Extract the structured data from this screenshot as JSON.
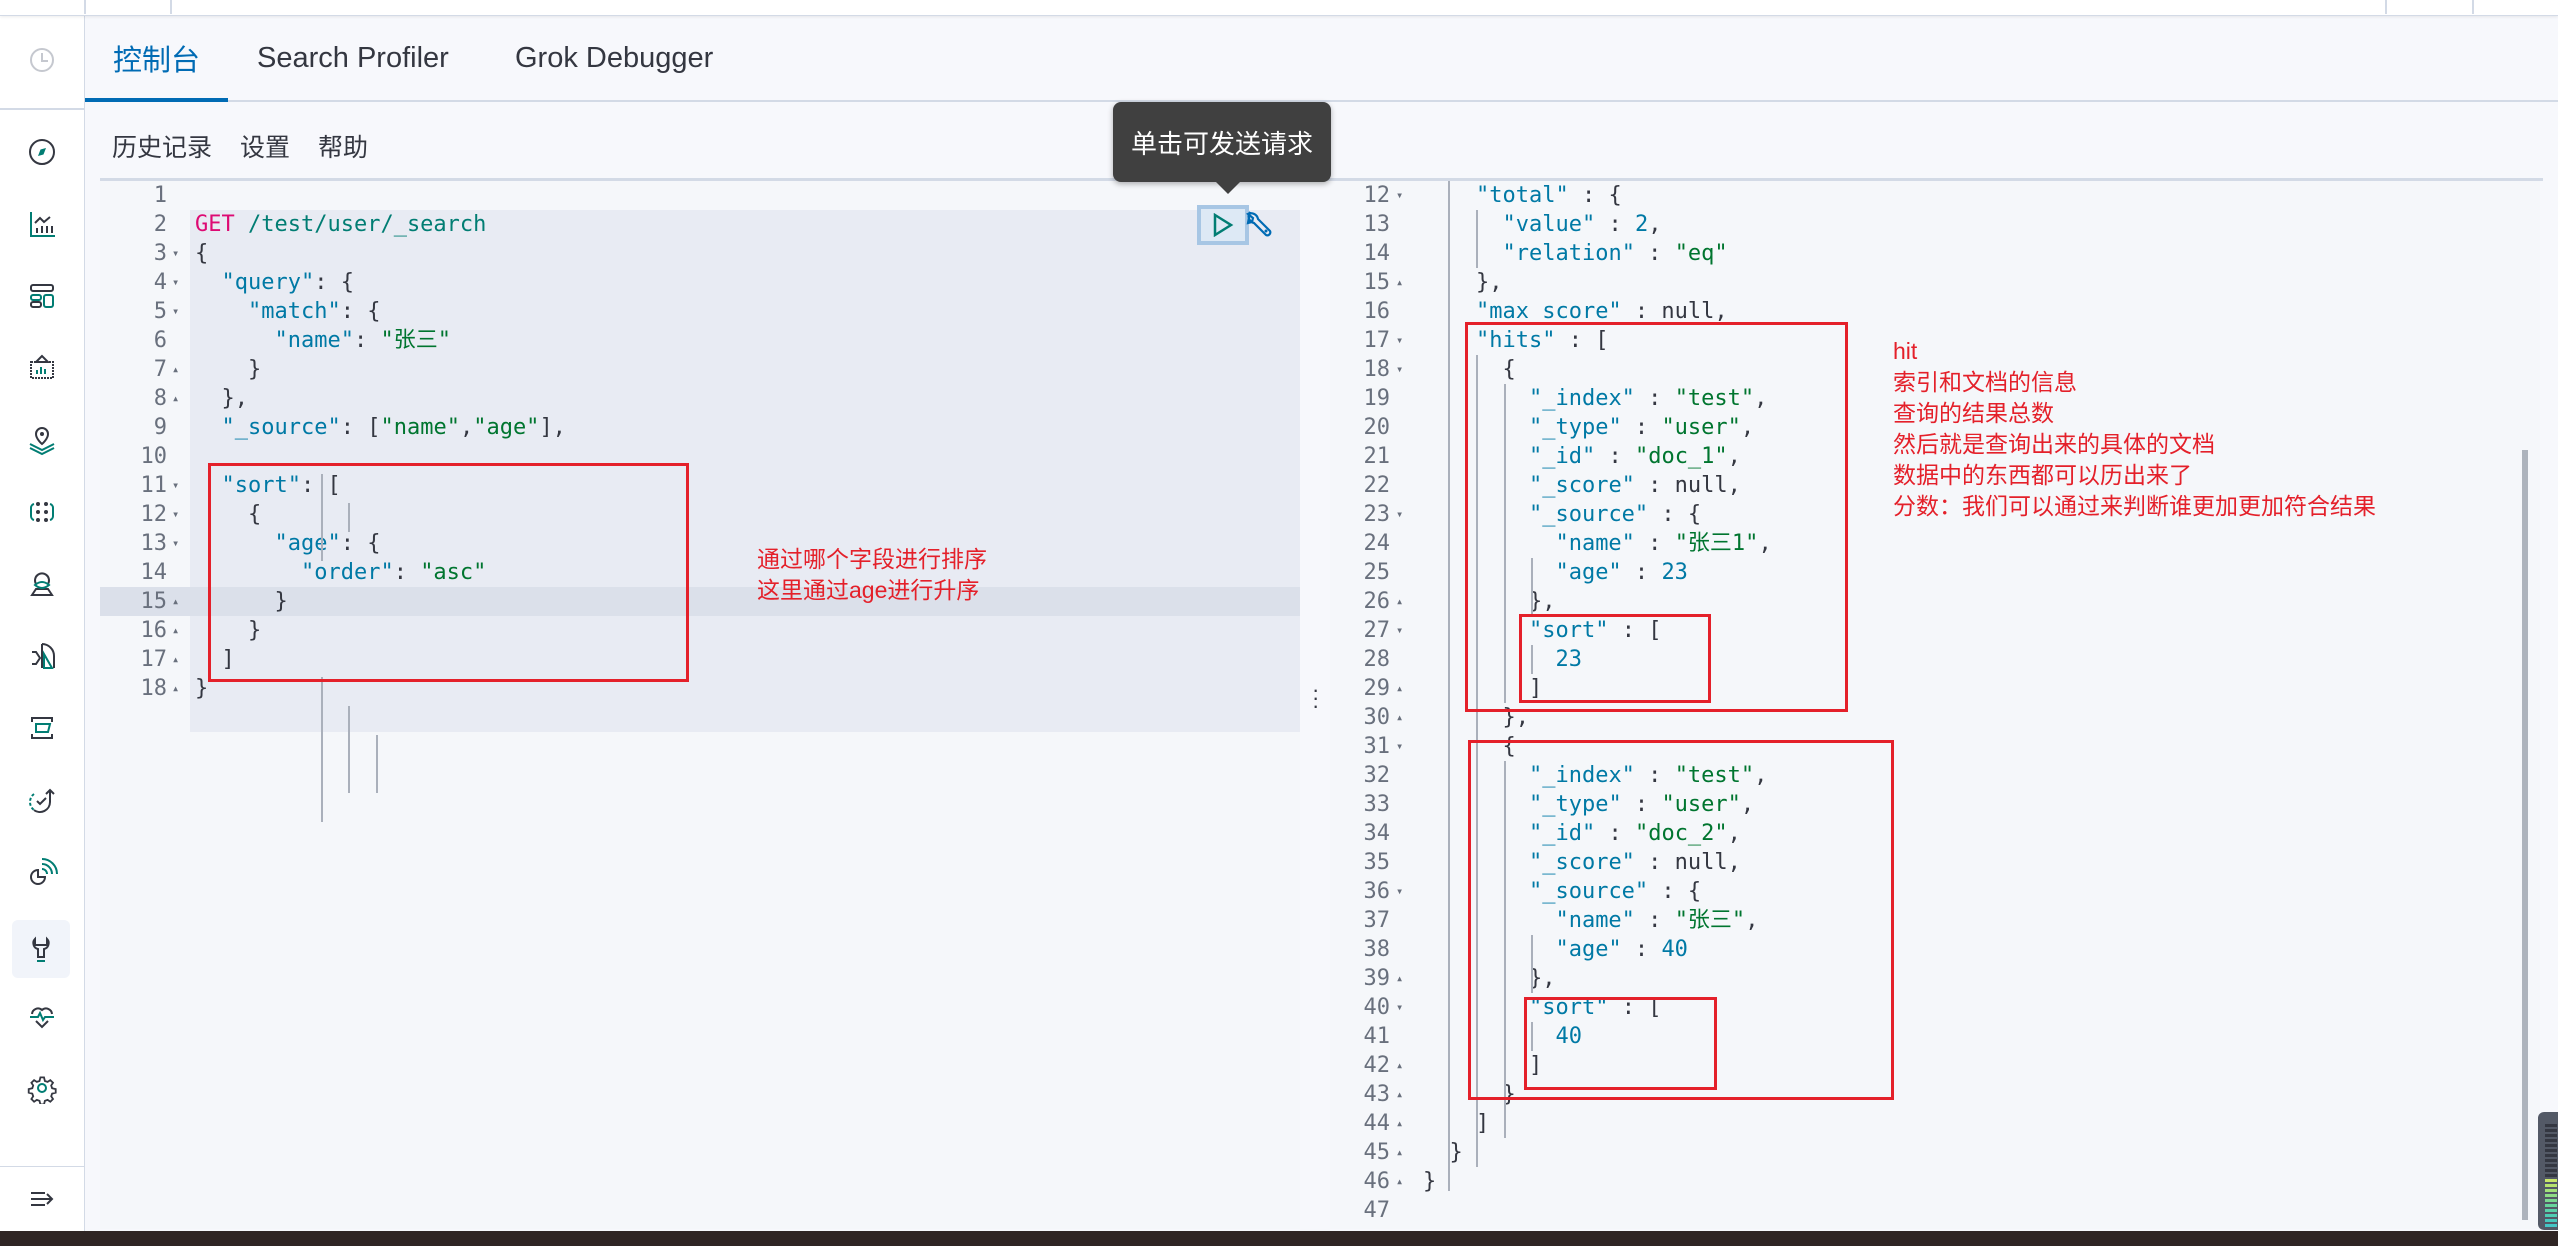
{
  "tabs": [
    {
      "label": "控制台",
      "active": true
    },
    {
      "label": "Search Profiler",
      "active": false
    },
    {
      "label": "Grok Debugger",
      "active": false
    }
  ],
  "submenu": [
    "历史记录",
    "设置",
    "帮助"
  ],
  "tooltip": "单击可发送请求",
  "nav_icons": [
    "clock-icon",
    "compass-icon",
    "visualize-icon",
    "dashboard-icon",
    "canvas-icon",
    "maps-icon",
    "ml-icon",
    "siem-icon",
    "observability-icon",
    "infrastructure-icon",
    "uptime-icon",
    "apm-icon",
    "dev-tools-icon",
    "monitoring-icon",
    "management-icon",
    "collapse-menu-icon"
  ],
  "request": {
    "lines": [
      {
        "n": "1",
        "fold": "",
        "html": ""
      },
      {
        "n": "2",
        "fold": "",
        "html": "<span class='m'>GET</span> <span class='cn'>/test/user/_search</span>"
      },
      {
        "n": "3",
        "fold": "▾",
        "html": "{"
      },
      {
        "n": "4",
        "fold": "▾",
        "html": "  <span class='k'>\"query\"</span>: {"
      },
      {
        "n": "5",
        "fold": "▾",
        "html": "    <span class='k'>\"match\"</span>: {"
      },
      {
        "n": "6",
        "fold": "",
        "html": "      <span class='k'>\"name\"</span>: <span class='u'>\"张三\"</span>"
      },
      {
        "n": "7",
        "fold": "▴",
        "html": "    }"
      },
      {
        "n": "8",
        "fold": "▴",
        "html": "  },"
      },
      {
        "n": "9",
        "fold": "",
        "html": "  <span class='k'>\"_source\"</span>: [<span class='u'>\"name\"</span>,<span class='u'>\"age\"</span>],"
      },
      {
        "n": "10",
        "fold": "",
        "html": ""
      },
      {
        "n": "11",
        "fold": "▾",
        "html": "  <span class='k'>\"sort\"</span>: ["
      },
      {
        "n": "12",
        "fold": "▾",
        "html": "    {"
      },
      {
        "n": "13",
        "fold": "▾",
        "html": "      <span class='k'>\"age\"</span>: {"
      },
      {
        "n": "14",
        "fold": "",
        "html": "        <span class='k'>\"order\"</span>: <span class='u'>\"asc\"</span>"
      },
      {
        "n": "15",
        "fold": "▴",
        "html": "      }"
      },
      {
        "n": "16",
        "fold": "▴",
        "html": "    }"
      },
      {
        "n": "17",
        "fold": "▴",
        "html": "  ]"
      },
      {
        "n": "18",
        "fold": "▴",
        "html": "}"
      }
    ]
  },
  "response": {
    "lines": [
      {
        "n": "12",
        "fold": "▾",
        "html": "    <span class='k'>\"total\"</span> : {"
      },
      {
        "n": "13",
        "fold": "",
        "html": "      <span class='k'>\"value\"</span> : <span class='num'>2</span>,"
      },
      {
        "n": "14",
        "fold": "",
        "html": "      <span class='k'>\"relation\"</span> : <span class='u'>\"eq\"</span>"
      },
      {
        "n": "15",
        "fold": "▴",
        "html": "    },"
      },
      {
        "n": "16",
        "fold": "",
        "html": "    <span class='k'>\"max_score\"</span> : null,"
      },
      {
        "n": "17",
        "fold": "▾",
        "html": "    <span class='k'>\"hits\"</span> : ["
      },
      {
        "n": "18",
        "fold": "▾",
        "html": "      {"
      },
      {
        "n": "19",
        "fold": "",
        "html": "        <span class='k'>\"_index\"</span> : <span class='u'>\"test\"</span>,"
      },
      {
        "n": "20",
        "fold": "",
        "html": "        <span class='k'>\"_type\"</span> : <span class='u'>\"user\"</span>,"
      },
      {
        "n": "21",
        "fold": "",
        "html": "        <span class='k'>\"_id\"</span> : <span class='u'>\"doc_1\"</span>,"
      },
      {
        "n": "22",
        "fold": "",
        "html": "        <span class='k'>\"_score\"</span> : null,"
      },
      {
        "n": "23",
        "fold": "▾",
        "html": "        <span class='k'>\"_source\"</span> : {"
      },
      {
        "n": "24",
        "fold": "",
        "html": "          <span class='k'>\"name\"</span> : <span class='u'>\"张三1\"</span>,"
      },
      {
        "n": "25",
        "fold": "",
        "html": "          <span class='k'>\"age\"</span> : <span class='num'>23</span>"
      },
      {
        "n": "26",
        "fold": "▴",
        "html": "        },"
      },
      {
        "n": "27",
        "fold": "▾",
        "html": "        <span class='k'>\"sort\"</span> : ["
      },
      {
        "n": "28",
        "fold": "",
        "html": "          <span class='num'>23</span>"
      },
      {
        "n": "29",
        "fold": "▴",
        "html": "        ]"
      },
      {
        "n": "30",
        "fold": "▴",
        "html": "      },"
      },
      {
        "n": "31",
        "fold": "▾",
        "html": "      {"
      },
      {
        "n": "32",
        "fold": "",
        "html": "        <span class='k'>\"_index\"</span> : <span class='u'>\"test\"</span>,"
      },
      {
        "n": "33",
        "fold": "",
        "html": "        <span class='k'>\"_type\"</span> : <span class='u'>\"user\"</span>,"
      },
      {
        "n": "34",
        "fold": "",
        "html": "        <span class='k'>\"_id\"</span> : <span class='u'>\"doc_2\"</span>,"
      },
      {
        "n": "35",
        "fold": "",
        "html": "        <span class='k'>\"_score\"</span> : null,"
      },
      {
        "n": "36",
        "fold": "▾",
        "html": "        <span class='k'>\"_source\"</span> : {"
      },
      {
        "n": "37",
        "fold": "",
        "html": "          <span class='k'>\"name\"</span> : <span class='u'>\"张三\"</span>,"
      },
      {
        "n": "38",
        "fold": "",
        "html": "          <span class='k'>\"age\"</span> : <span class='num'>40</span>"
      },
      {
        "n": "39",
        "fold": "▴",
        "html": "        },"
      },
      {
        "n": "40",
        "fold": "▾",
        "html": "        <span class='k'>\"sort\"</span> : ["
      },
      {
        "n": "41",
        "fold": "",
        "html": "          <span class='num'>40</span>"
      },
      {
        "n": "42",
        "fold": "▴",
        "html": "        ]"
      },
      {
        "n": "43",
        "fold": "▴",
        "html": "      }"
      },
      {
        "n": "44",
        "fold": "▴",
        "html": "    ]"
      },
      {
        "n": "45",
        "fold": "▴",
        "html": "  }"
      },
      {
        "n": "46",
        "fold": "▴",
        "html": "}"
      },
      {
        "n": "47",
        "fold": "",
        "html": ""
      }
    ]
  },
  "annotations": {
    "sort_note": [
      "通过哪个字段进行排序",
      "这里通过age进行升序"
    ],
    "hits_note": [
      "hit",
      "索引和文档的信息",
      "查询的结果总数",
      "然后就是查询出来的具体的文档",
      "数据中的东西都可以历出来了",
      "分数：我们可以通过来判断谁更加更加符合结果"
    ]
  },
  "colors": {
    "accent": "#006bb4",
    "annotation": "#e4202a",
    "run_button": "#017d73"
  }
}
